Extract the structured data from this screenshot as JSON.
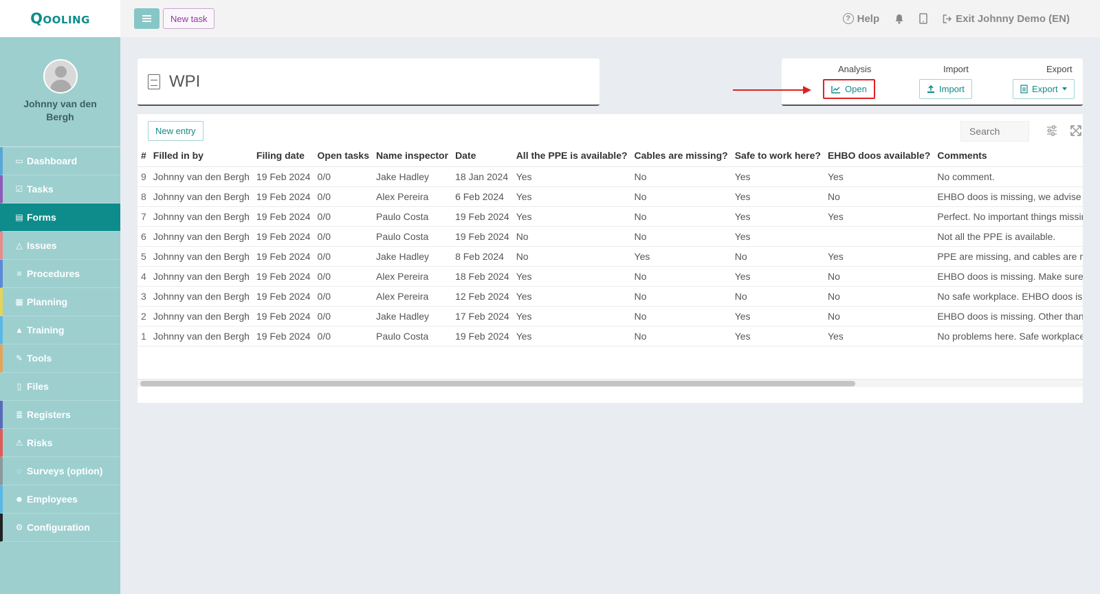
{
  "app": {
    "logo": "Qooling",
    "new_task": "New task"
  },
  "topnav": {
    "help": "Help",
    "help_glyph": "?",
    "exit": "Exit Johnny Demo (EN)"
  },
  "sidebar": {
    "user_name": "Johnny van den Bergh",
    "items": [
      {
        "label": "Dashboard",
        "icon": "monitor-icon",
        "glyph": "▭",
        "color": "#5aa6d8"
      },
      {
        "label": "Tasks",
        "icon": "check-square-icon",
        "glyph": "☑",
        "color": "#8e5bb8"
      },
      {
        "label": "Forms",
        "icon": "document-icon",
        "glyph": "▤",
        "color": "#0e8c8c"
      },
      {
        "label": "Issues",
        "icon": "bell-icon",
        "glyph": "△",
        "color": "#e98b8b"
      },
      {
        "label": "Procedures",
        "icon": "list-icon",
        "glyph": "≡",
        "color": "#5b8ad8"
      },
      {
        "label": "Planning",
        "icon": "calendar-icon",
        "glyph": "▦",
        "color": "#e6d35a"
      },
      {
        "label": "Training",
        "icon": "graduation-cap-icon",
        "glyph": "▲",
        "color": "#5ab8e6"
      },
      {
        "label": "Tools",
        "icon": "wrench-icon",
        "glyph": "✎",
        "color": "#e6a35a"
      },
      {
        "label": "Files",
        "icon": "file-icon",
        "glyph": "▯",
        "color": "#9dcfcf"
      },
      {
        "label": "Registers",
        "icon": "registers-icon",
        "glyph": "≣",
        "color": "#5a6ab8"
      },
      {
        "label": "Risks",
        "icon": "warning-icon",
        "glyph": "⚠",
        "color": "#e05a5a"
      },
      {
        "label": "Surveys (option)",
        "icon": "comment-icon",
        "glyph": "◌",
        "color": "#8a9a9a"
      },
      {
        "label": "Employees",
        "icon": "users-icon",
        "glyph": "☻",
        "color": "#5ab8e6"
      },
      {
        "label": "Configuration",
        "icon": "gear-icon",
        "glyph": "⚙",
        "color": "#222222"
      }
    ]
  },
  "header": {
    "title": "WPI"
  },
  "actions": {
    "analysis_label": "Analysis",
    "open_label": "Open",
    "import_label": "Import",
    "import_button": "Import",
    "export_label": "Export",
    "export_button": "Export"
  },
  "table": {
    "new_entry": "New entry",
    "search_placeholder": "Search",
    "columns": [
      "#",
      "Filled in by",
      "Filing date",
      "Open tasks",
      "Name inspector",
      "Date",
      "All the PPE is available?",
      "Cables are missing?",
      "Safe to work here?",
      "EHBO doos available?",
      "Comments"
    ],
    "rows": [
      [
        "9",
        "Johnny van den Bergh",
        "19 Feb 2024",
        "0/0",
        "Jake Hadley",
        "18 Jan 2024",
        "Yes",
        "No",
        "Yes",
        "Yes",
        "No comment."
      ],
      [
        "8",
        "Johnny van den Bergh",
        "19 Feb 2024",
        "0/0",
        "Alex Pereira",
        "6 Feb 2024",
        "Yes",
        "No",
        "Yes",
        "No",
        "EHBO doos is missing, we advise to buy one ."
      ],
      [
        "7",
        "Johnny van den Bergh",
        "19 Feb 2024",
        "0/0",
        "Paulo Costa",
        "19 Feb 2024",
        "Yes",
        "No",
        "Yes",
        "Yes",
        "Perfect. No important things missing."
      ],
      [
        "6",
        "Johnny van den Bergh",
        "19 Feb 2024",
        "0/0",
        "Paulo Costa",
        "19 Feb 2024",
        "No",
        "No",
        "Yes",
        "",
        "Not all the PPE is available."
      ],
      [
        "5",
        "Johnny van den Bergh",
        "19 Feb 2024",
        "0/0",
        "Jake Hadley",
        "8 Feb 2024",
        "No",
        "Yes",
        "No",
        "Yes",
        "PPE are missing, and cables are missing as w"
      ],
      [
        "4",
        "Johnny van den Bergh",
        "19 Feb 2024",
        "0/0",
        "Alex Pereira",
        "18 Feb 2024",
        "Yes",
        "No",
        "Yes",
        "No",
        "EHBO doos is missing. Make sure there is one"
      ],
      [
        "3",
        "Johnny van den Bergh",
        "19 Feb 2024",
        "0/0",
        "Alex Pereira",
        "12 Feb 2024",
        "Yes",
        "No",
        "No",
        "No",
        "No safe workplace. EHBO doos is missing, ca"
      ],
      [
        "2",
        "Johnny van den Bergh",
        "19 Feb 2024",
        "0/0",
        "Jake Hadley",
        "17 Feb 2024",
        "Yes",
        "No",
        "Yes",
        "No",
        "EHBO doos is missing. Other than that a safe"
      ],
      [
        "1",
        "Johnny van den Bergh",
        "19 Feb 2024",
        "0/0",
        "Paulo Costa",
        "19 Feb 2024",
        "Yes",
        "No",
        "Yes",
        "Yes",
        "No problems here. Safe workplace"
      ]
    ]
  },
  "colors": {
    "brand": "#0e8c8c",
    "sidebar": "#9dcfcf",
    "highlight": "#e02020"
  }
}
